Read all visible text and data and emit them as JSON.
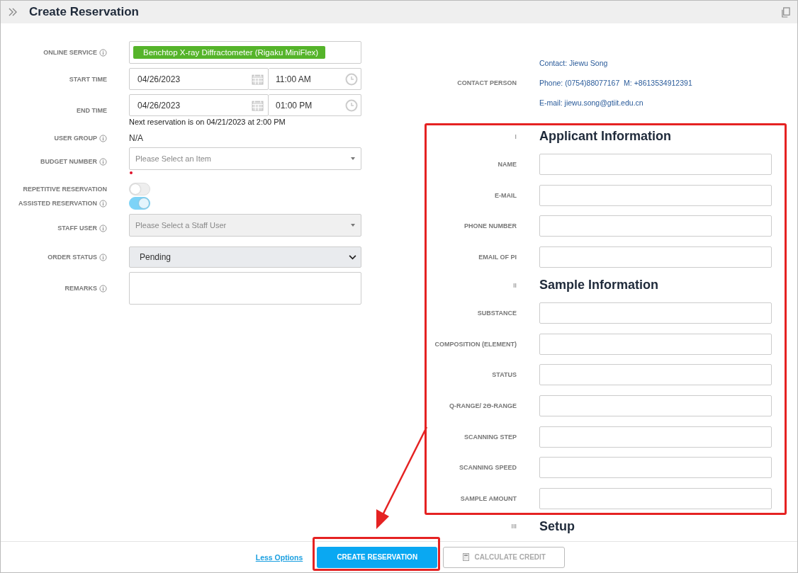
{
  "header": {
    "title": "Create Reservation"
  },
  "left_fields": [
    {
      "kind": "tag",
      "label": "ONLINE SERVICE",
      "info": true,
      "value": "Benchtop X-ray Diffractometer (Rigaku MiniFlex)"
    },
    {
      "kind": "datetime",
      "label": "START TIME",
      "info": false,
      "date": "04/26/2023",
      "time": "11:00 AM"
    },
    {
      "kind": "datetime",
      "label": "END TIME",
      "info": false,
      "date": "04/26/2023",
      "time": "01:00 PM",
      "note": "Next reservation is on 04/21/2023 at 2:00 PM"
    },
    {
      "kind": "text",
      "label": "USER GROUP",
      "info": true,
      "value": "N/A"
    },
    {
      "kind": "select",
      "label": "BUDGET NUMBER",
      "info": true,
      "placeholder": "Please Select an Item",
      "disabled": false,
      "required": true
    },
    {
      "kind": "toggle",
      "label": "REPETITIVE RESERVATION",
      "info": false,
      "on": false
    },
    {
      "kind": "toggle",
      "label": "ASSISTED RESERVATION",
      "info": true,
      "on": true
    },
    {
      "kind": "select",
      "label": "STAFF USER",
      "info": true,
      "placeholder": "Please Select a Staff User",
      "disabled": true,
      "required": false
    },
    {
      "kind": "native-select",
      "label": "ORDER STATUS",
      "info": true,
      "value": "Pending"
    },
    {
      "kind": "textarea",
      "label": "REMARKS",
      "info": true
    }
  ],
  "contact": {
    "label": "CONTACT PERSON",
    "lines": [
      "Contact: Jiewu Song",
      "Phone: (0754)88077167  M: +8613534912391",
      "E-mail: jiewu.song@gtiit.edu.cn"
    ]
  },
  "sections": [
    {
      "number": "I",
      "title": "Applicant Information",
      "fields": [
        "NAME",
        "E-MAIL",
        "PHONE NUMBER",
        "EMAIL OF PI"
      ]
    },
    {
      "number": "II",
      "title": "Sample Information",
      "fields": [
        "SUBSTANCE",
        "COMPOSITION (ELEMENT)",
        "STATUS",
        "Q-RANGE/ 2Θ-RANGE",
        "SCANNING STEP",
        "SCANNING SPEED",
        "SAMPLE AMOUNT"
      ]
    },
    {
      "number": "III",
      "title": "Setup"
    }
  ],
  "footer": {
    "link": "Less Options",
    "primary": "CREATE RESERVATION",
    "secondary": "CALCULATE CREDIT"
  }
}
